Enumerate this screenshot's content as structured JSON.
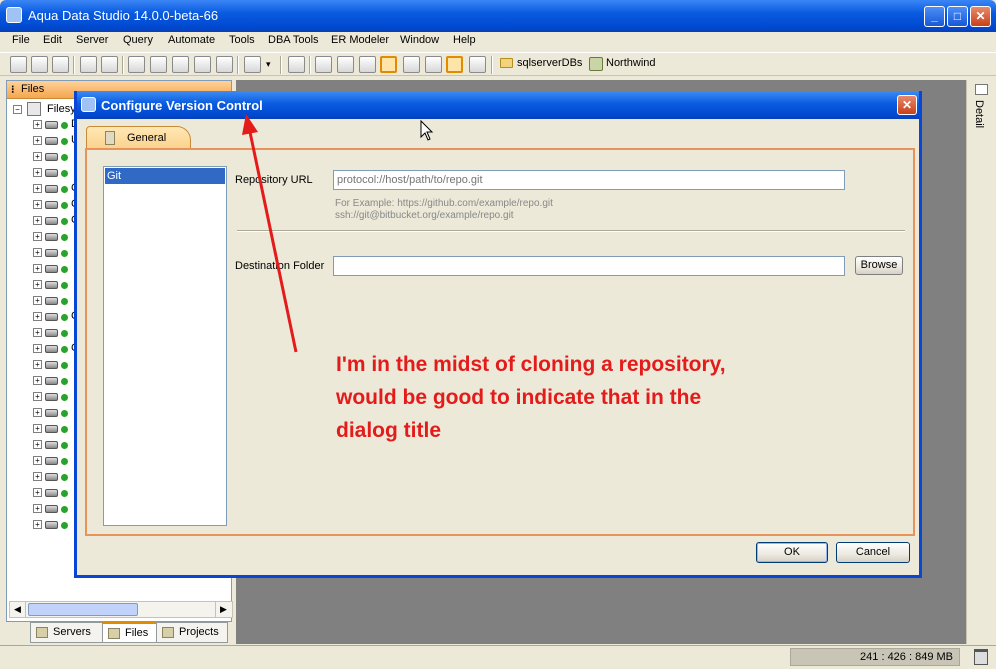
{
  "app": {
    "title": "Aqua Data Studio 14.0.0-beta-66"
  },
  "menubar": {
    "items": [
      "File",
      "Edit",
      "Server",
      "Query",
      "Automate",
      "Tools",
      "DBA Tools",
      "ER Modeler",
      "Window",
      "Help"
    ]
  },
  "toolbar": {
    "servers_label": "sqlserverDBs",
    "db_label": "Northwind"
  },
  "left_panel": {
    "title": "Files",
    "root_label": "Filesy",
    "row_chars": [
      "D",
      "U",
      "",
      "",
      "C",
      "C",
      "C",
      "",
      "",
      "",
      "",
      "",
      "C",
      "",
      "C",
      "",
      "",
      "",
      "",
      "",
      "",
      "",
      "",
      "",
      "",
      ""
    ],
    "tabs": [
      "Servers",
      "Files",
      "Projects"
    ]
  },
  "right_strip": {
    "label": "Detail"
  },
  "status": {
    "memory": "241 : 426 : 849 MB"
  },
  "dialog": {
    "title": "Configure Version Control",
    "tab": "General",
    "vcs_list": [
      "Git"
    ],
    "repo_url_label": "Repository URL",
    "repo_url_placeholder": "protocol://host/path/to/repo.git",
    "example_line1": "For Example: https://github.com/example/repo.git",
    "example_line2": "ssh://git@bitbucket.org/example/repo.git",
    "dest_label": "Destination Folder",
    "dest_value": "",
    "browse_label": "Browse",
    "ok_label": "OK",
    "cancel_label": "Cancel"
  },
  "annotation": {
    "text": "I'm in the midst of cloning a repository, would be good to indicate that in the dialog title",
    "color": "#e41b1b"
  }
}
